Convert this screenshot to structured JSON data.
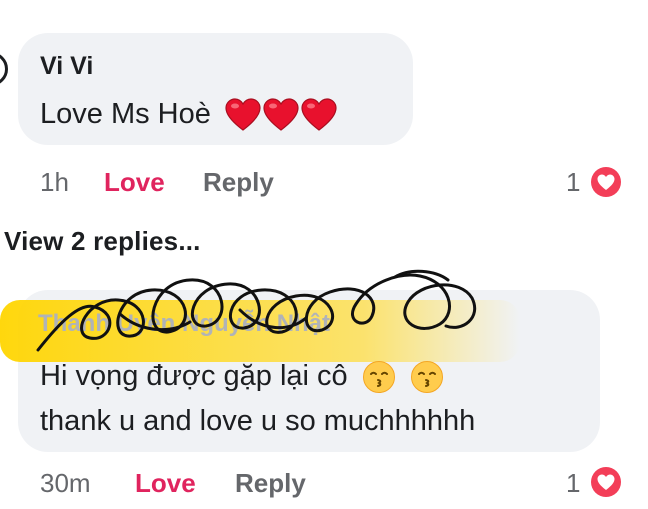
{
  "comments": [
    {
      "author": "Vi Vi",
      "text": "Love Ms Hoè",
      "hearts": 3,
      "time": "1h",
      "love_label": "Love",
      "reply_label": "Reply",
      "reaction_count": "1",
      "reaction_icon": "love-reaction-icon"
    },
    {
      "author": "Thanh Uyên Nguyễn Nhật",
      "text_line1": "Hi vọng được gặp lại cô",
      "text_line2": "thank u and love u so muchhhhhh",
      "time": "30m",
      "love_label": "Love",
      "reply_label": "Reply",
      "reaction_count": "1",
      "reaction_icon": "love-reaction-icon",
      "emojis": [
        "kissing-face-icon",
        "kissing-face-icon"
      ]
    }
  ],
  "view_replies_label": "View 2 replies...",
  "colors": {
    "bubble": "#f0f2f5",
    "love": "#e0245e",
    "muted": "#65676b",
    "highlight": "#ffd500"
  }
}
